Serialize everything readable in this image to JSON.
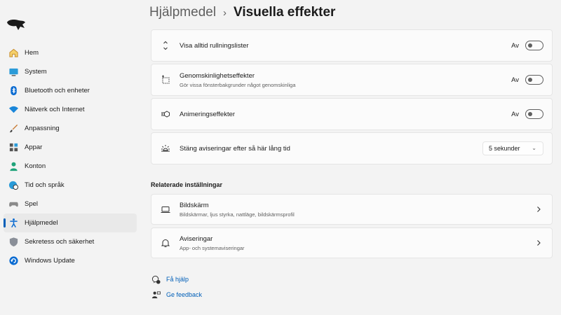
{
  "sidebar": {
    "items": [
      {
        "label": "Hem",
        "icon": "home-icon"
      },
      {
        "label": "System",
        "icon": "monitor-icon"
      },
      {
        "label": "Bluetooth och enheter",
        "icon": "bluetooth-icon"
      },
      {
        "label": "Nätverk och Internet",
        "icon": "wifi-icon"
      },
      {
        "label": "Anpassning",
        "icon": "brush-icon"
      },
      {
        "label": "Appar",
        "icon": "apps-icon"
      },
      {
        "label": "Konton",
        "icon": "person-icon"
      },
      {
        "label": "Tid och språk",
        "icon": "globe-clock-icon"
      },
      {
        "label": "Spel",
        "icon": "gamepad-icon"
      },
      {
        "label": "Hjälpmedel",
        "icon": "accessibility-icon",
        "active": true
      },
      {
        "label": "Sekretess och säkerhet",
        "icon": "shield-icon"
      },
      {
        "label": "Windows Update",
        "icon": "update-icon"
      }
    ]
  },
  "header": {
    "parent": "Hjälpmedel",
    "separator": "›",
    "current": "Visuella effekter"
  },
  "settings": {
    "scrollbars": {
      "title": "Visa alltid rullningslister",
      "state": "Av",
      "icon": "scroll-arrows-icon"
    },
    "transparency": {
      "title": "Genomskinlighetseffekter",
      "subtitle": "Gör vissa fönsterbakgrunder något genomskinliga",
      "state": "Av",
      "icon": "transparency-icon"
    },
    "animation": {
      "title": "Animeringseffekter",
      "state": "Av",
      "icon": "animation-icon"
    },
    "notifications": {
      "title": "Stäng aviseringar efter så här lång tid",
      "value": "5 sekunder",
      "icon": "brightness-icon"
    }
  },
  "related": {
    "heading": "Relaterade inställningar",
    "display": {
      "title": "Bildskärm",
      "subtitle": "Bildskärmar, ljus styrka, nattläge, bildskärmsprofil",
      "icon": "laptop-icon"
    },
    "notifications": {
      "title": "Aviseringar",
      "subtitle": "App- och systemaviseringar",
      "icon": "bell-icon"
    }
  },
  "footer": {
    "help": "Få hjälp",
    "feedback": "Ge feedback"
  },
  "colors": {
    "accent": "#005fb8",
    "background": "#f3f3f3",
    "card": "#fbfbfb"
  }
}
